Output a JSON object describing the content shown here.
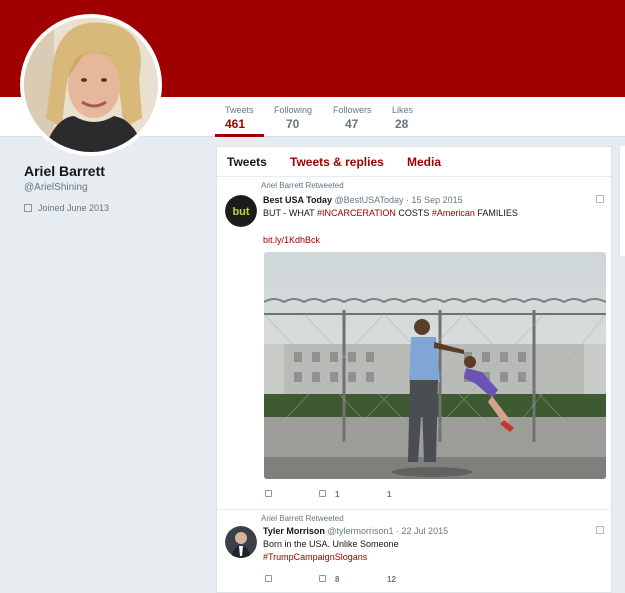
{
  "colors": {
    "brand": "#a00000",
    "background": "#e6ecf0"
  },
  "stats": [
    {
      "label": "Tweets",
      "value": "461"
    },
    {
      "label": "Following",
      "value": "70"
    },
    {
      "label": "Followers",
      "value": "47"
    },
    {
      "label": "Likes",
      "value": "28"
    }
  ],
  "profile": {
    "name": "Ariel Barrett",
    "handle": "@ArielShining",
    "joined": "Joined June 2013",
    "joined_icon": "calendar-icon"
  },
  "timeline": {
    "tabs": [
      "Tweets",
      "Tweets & replies",
      "Media"
    ],
    "tweets": [
      {
        "retweet_label": "Ariel Barrett Retweeted",
        "author_name": "Best USA Today",
        "author_handle": "@BestUSAToday",
        "date": "· 15 Sep 2015",
        "avatar_text": "but",
        "text_parts": [
          "BUT - WHAT ",
          "#INCARCERATION",
          " COSTS ",
          "#American",
          " FAMILIES"
        ],
        "link": "bit.ly/1KdhBck",
        "actions": {
          "retweets": "1",
          "likes": "1"
        }
      },
      {
        "retweet_label": "Ariel Barrett Retweeted",
        "author_name": "Tyler Morrison",
        "author_handle": "@tylermorrison1",
        "date": "· 22 Jul 2015",
        "text": "Born in the USA. Unlike Someone",
        "hashtag": "#TrumpCampaignSlogans",
        "actions": {
          "retweets": "8",
          "likes": "12"
        }
      }
    ]
  }
}
